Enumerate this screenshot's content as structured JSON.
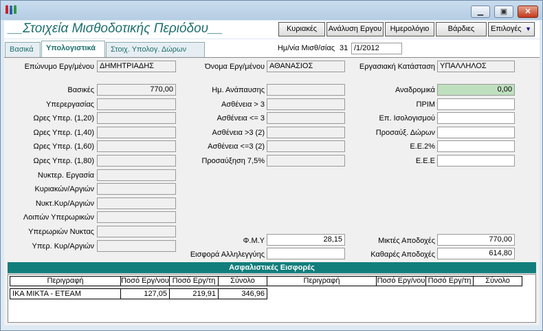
{
  "header": {
    "title": "__Στοιχεία Μισθοδοτικής Περιόδου__",
    "buttons": {
      "sundays": "Κυριακές",
      "analysis": "Ανάλυση Εργου",
      "calendar": "Ημερολόγιο",
      "shifts": "Βάρδιες",
      "options": "Επιλογές"
    }
  },
  "tabs": {
    "basic": "Βασικά",
    "calc": "Υπολογιστικά",
    "gifts": "Στοιχ. Υπολογ. Δώρων"
  },
  "payroll_date": {
    "label": "Ημ/νία Μισθ/σίας",
    "day": "31",
    "rest": "/1/2012"
  },
  "employee": {
    "surname_label": "Επώνυμο Εργ/μένου",
    "surname": "ΔΗΜΗΤΡΙΑΔΗΣ",
    "name_label": "Όνομα Εργ/μένου",
    "name": "ΑΘΑΝΑΣΙΟΣ",
    "status_label": "Εργασιακή Κατάσταση",
    "status": "ΥΠΑΛΛΗΛΟΣ"
  },
  "col1": [
    {
      "label": "Βασικές",
      "value": "770,00"
    },
    {
      "label": "Υπερεργασίας",
      "value": ""
    },
    {
      "label": "Ωρες Υπερ. (1,20)",
      "value": ""
    },
    {
      "label": "Ωρες Υπερ. (1,40)",
      "value": ""
    },
    {
      "label": "Ωρες Υπερ. (1,60)",
      "value": ""
    },
    {
      "label": "Ωρες Υπερ. (1,80)",
      "value": ""
    },
    {
      "label": "Νυκτερ. Εργασία",
      "value": ""
    },
    {
      "label": "Κυριακών/Αργιών",
      "value": ""
    },
    {
      "label": "Νυκτ.Κυρ/Αργιών",
      "value": ""
    },
    {
      "label": "Λοιπών Υπερωρικών",
      "value": ""
    },
    {
      "label": "Υπερωριών Νυκτας",
      "value": ""
    },
    {
      "label": "Υπερ. Κυρ/Αργιών",
      "value": ""
    }
  ],
  "col2": [
    {
      "label": "Ημ. Ανάπαυσης",
      "value": ""
    },
    {
      "label": "Ασθένεια > 3",
      "value": ""
    },
    {
      "label": "Ασθένεια <= 3",
      "value": ""
    },
    {
      "label": "Ασθένεια >3 (2)",
      "value": ""
    },
    {
      "label": "Ασθένεια <=3 (2)",
      "value": ""
    },
    {
      "label": "Προσαύξηση 7,5%",
      "value": ""
    }
  ],
  "col3": [
    {
      "label": "Αναδρομικά",
      "value": "0,00"
    },
    {
      "label": "ΠΡΙΜ",
      "value": ""
    },
    {
      "label": "Επ. Ισολογισμού",
      "value": ""
    },
    {
      "label": "Προσαύξ. Δώρων",
      "value": ""
    },
    {
      "label": "Ε.Ε.2%",
      "value": ""
    },
    {
      "label": "Ε.Ε.Ε",
      "value": ""
    }
  ],
  "fmy": {
    "label": "Φ.Μ.Υ",
    "value": "28,15"
  },
  "solidarity": {
    "label": "Εισφορά Αλληλεγγύης",
    "value": ""
  },
  "gross": {
    "label": "Μικτές Αποδοχές",
    "value": "770,00"
  },
  "net": {
    "label": "Καθαρές Αποδοχές",
    "value": "614,80"
  },
  "insurance": {
    "title": "Ασφαλιστικές Εισφορές",
    "headers": [
      "Περιγραφή",
      "Ποσό Εργ/νου",
      "Ποσό Εργ/τη",
      "Σύνολο",
      "Περιγραφή",
      "Ποσό Εργ/νου",
      "Ποσό Εργ/τη",
      "Σύνολο"
    ],
    "rows": [
      {
        "desc": "ΙΚΑ ΜΙΚΤΑ - ΕΤΕΑΜ",
        "emp": "127,05",
        "empr": "219,91",
        "total": "346,96"
      }
    ]
  }
}
